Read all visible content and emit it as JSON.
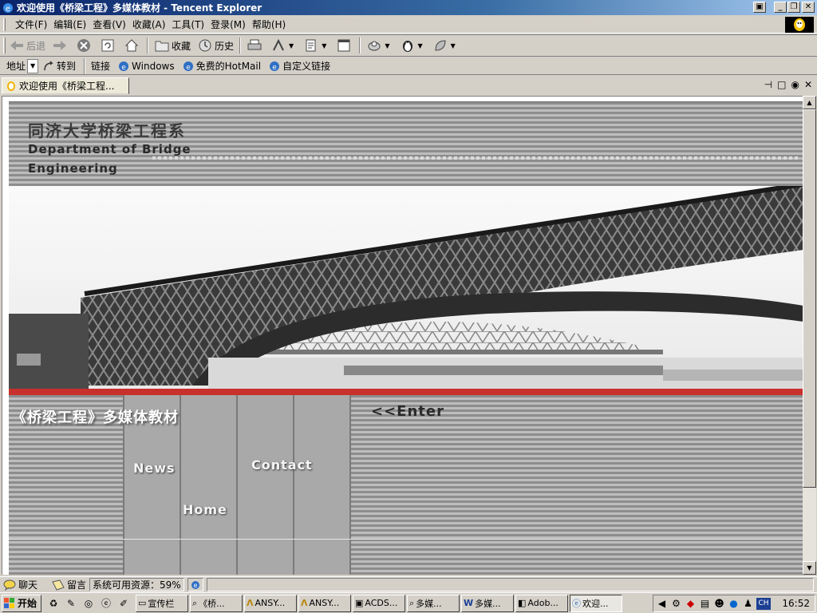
{
  "window": {
    "title": "欢迎使用《桥梁工程》多媒体教材 - Tencent Explorer"
  },
  "menu": {
    "items": [
      "文件(F)",
      "编辑(E)",
      "查看(V)",
      "收藏(A)",
      "工具(T)",
      "登录(M)",
      "帮助(H)"
    ]
  },
  "toolbar": {
    "back": "后退",
    "favorites": "收藏",
    "history": "历史"
  },
  "address": {
    "label": "地址",
    "go": "转到",
    "links_label": "链接",
    "links": [
      "Windows",
      "免费的HotMail",
      "自定义链接"
    ]
  },
  "tab": {
    "title": "欢迎使用《桥梁工程...",
    "pin_icon": "pin-icon"
  },
  "page": {
    "header_cn": "同济大学桥梁工程系",
    "header_en_1": "Department of Bridge",
    "header_en_2": "Engineering",
    "nav_title": "《桥梁工程》多媒体教材",
    "nav_news": "News",
    "nav_home": "Home",
    "nav_contact": "Contact",
    "enter": "<<Enter",
    "accent_color": "#c8302b"
  },
  "statusbar": {
    "chat": "聊天",
    "message": "留言",
    "resources": "系统可用资源：59%"
  },
  "taskbar": {
    "start": "开始",
    "tasks": [
      "宣传栏",
      "《桥...",
      "ANSY...",
      "ANSY...",
      "ACDS...",
      "多媒...",
      "多媒...",
      "Adob...",
      "欢迎..."
    ],
    "active_task_index": 8,
    "tray_lang": "CH",
    "clock": "16:52"
  }
}
